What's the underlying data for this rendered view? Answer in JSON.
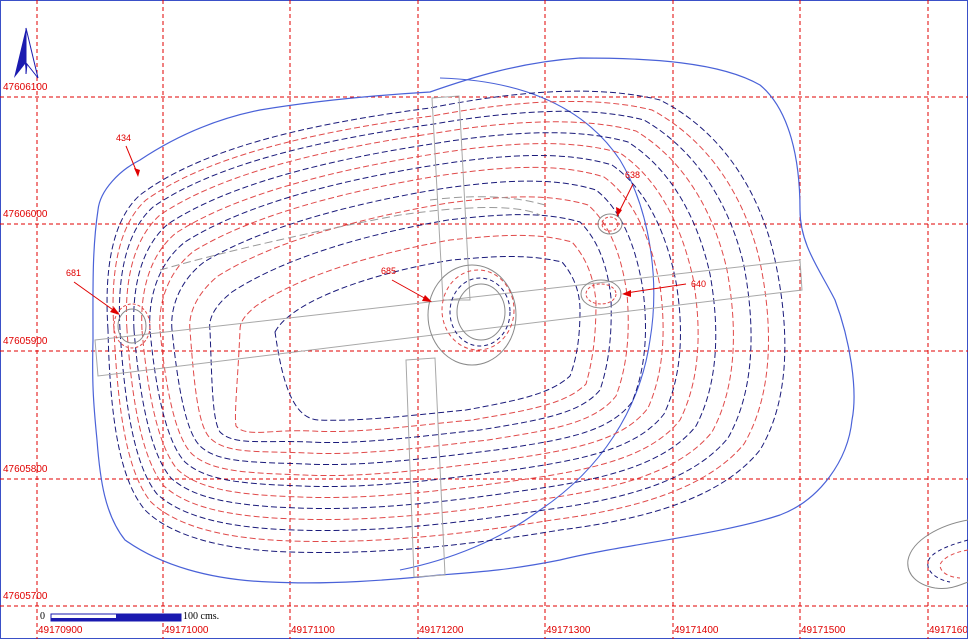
{
  "map": {
    "easting_labels": [
      "49170900",
      "49171000",
      "49171100",
      "49171200",
      "49171300",
      "49171400",
      "49171500",
      "49171600"
    ],
    "northing_labels": [
      "47606100",
      "47606000",
      "47605900",
      "47605800",
      "47605700"
    ],
    "features": [
      {
        "id": "434",
        "label": "434"
      },
      {
        "id": "681",
        "label": "681"
      },
      {
        "id": "685",
        "label": "685"
      },
      {
        "id": "638",
        "label": "638"
      },
      {
        "id": "640",
        "label": "640"
      }
    ],
    "scale": {
      "start_label": "0",
      "end_label": "100 cms."
    },
    "north_arrow": {
      "icon": "north-arrow-icon"
    },
    "colors": {
      "grid": "#e00000",
      "outline": "#4a62d8",
      "contour_dark": "#1a1a7a",
      "contour_red": "#e04a4a",
      "section": "#a0a0a0"
    }
  }
}
